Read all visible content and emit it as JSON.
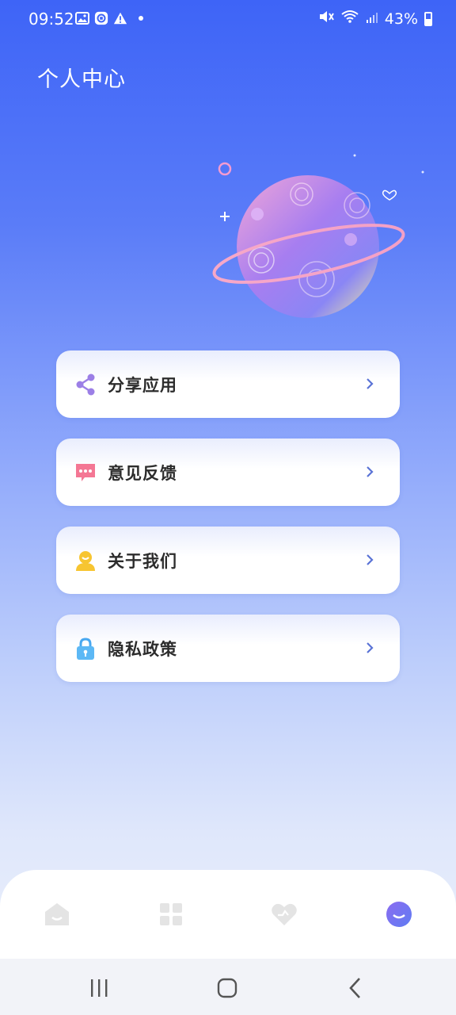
{
  "status_bar": {
    "time": "09:52",
    "battery": "43%",
    "battery_level": 0.43
  },
  "page": {
    "title": "个人中心"
  },
  "menu": {
    "items": [
      {
        "label": "分享应用",
        "icon": "share-icon"
      },
      {
        "label": "意见反馈",
        "icon": "feedback-icon"
      },
      {
        "label": "关于我们",
        "icon": "about-icon"
      },
      {
        "label": "隐私政策",
        "icon": "lock-icon"
      }
    ]
  },
  "bottom_nav": {
    "items": [
      {
        "icon": "home-icon",
        "active": false
      },
      {
        "icon": "grid-icon",
        "active": false
      },
      {
        "icon": "heart-icon",
        "active": false
      },
      {
        "icon": "profile-icon",
        "active": true
      }
    ]
  },
  "colors": {
    "accent": "#3e64f7",
    "active_nav": "#6b74ee",
    "inactive_nav": "#e4e4e4"
  }
}
